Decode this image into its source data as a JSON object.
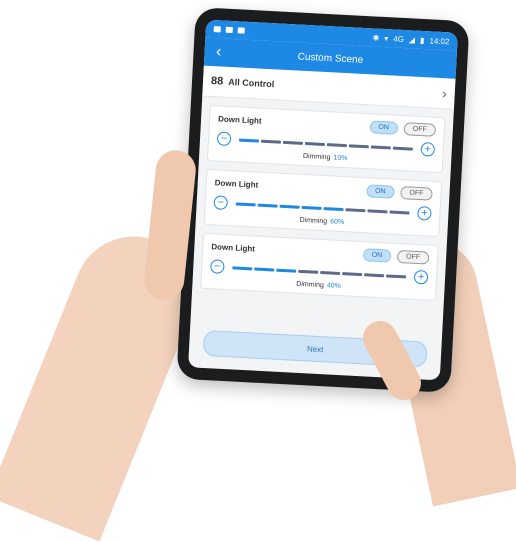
{
  "status_bar": {
    "time": "14:02",
    "network": "4G"
  },
  "header": {
    "title": "Custom Scene",
    "back_icon": "chevron-left-icon"
  },
  "all_control": {
    "label": "All Control",
    "icon": "grid-icon",
    "chevron": "chevron-right-icon"
  },
  "cards": [
    {
      "title": "Down Light",
      "on_label": "ON",
      "off_label": "OFF",
      "dimming_label": "Dimming",
      "dimming_value": "10%",
      "level": 0.1
    },
    {
      "title": "Down Light",
      "on_label": "ON",
      "off_label": "OFF",
      "dimming_label": "Dimming",
      "dimming_value": "60%",
      "level": 0.6
    },
    {
      "title": "Down Light",
      "on_label": "ON",
      "off_label": "OFF",
      "dimming_label": "Dimming",
      "dimming_value": "40%",
      "level": 0.4
    }
  ],
  "next_button": {
    "label": "Next"
  },
  "colors": {
    "accent": "#1e88e5",
    "track": "#5c6b87"
  }
}
